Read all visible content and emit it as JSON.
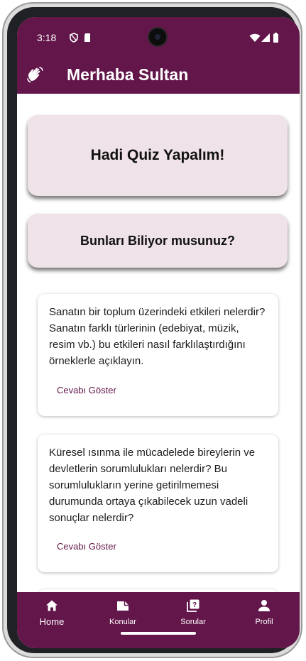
{
  "status_bar": {
    "time": "3:18",
    "left_icons": [
      "vpn-shield-icon",
      "sd-card-icon"
    ],
    "right_icons": [
      "wifi-icon",
      "cellular-signal-icon",
      "battery-icon"
    ]
  },
  "app_bar": {
    "icon": "waving-hand-icon",
    "title": "Merhaba Sultan"
  },
  "cards": {
    "quiz": "Hadi Quiz Yapalım!",
    "did_you_know": "Bunları Biliyor musunuz?"
  },
  "questions": [
    {
      "text": "Sanatın bir toplum üzerindeki etkileri nelerdir? Sanatın farklı türlerinin (edebiyat, müzik, resim vb.) bu etkileri nasıl farklılaştırdığını örneklerle açıklayın.",
      "action": "Cevabı Göster"
    },
    {
      "text": "Küresel ısınma ile mücadelede bireylerin ve devletlerin sorumlulukları nelerdir? Bu sorumlulukların yerine getirilmemesi durumunda ortaya çıkabilecek uzun vadeli sonuçlar nelerdir?",
      "action": "Cevabı Göster"
    }
  ],
  "bottom_nav": [
    {
      "label": "Home",
      "icon": "home-icon",
      "selected": true
    },
    {
      "label": "Konular",
      "icon": "folder-icon",
      "selected": false
    },
    {
      "label": "Sorular",
      "icon": "question-icon",
      "selected": false
    },
    {
      "label": "Profil",
      "icon": "person-icon",
      "selected": false
    }
  ],
  "colors": {
    "primary": "#63164a",
    "card_background": "#efe2e9",
    "on_primary": "#ffffff"
  }
}
